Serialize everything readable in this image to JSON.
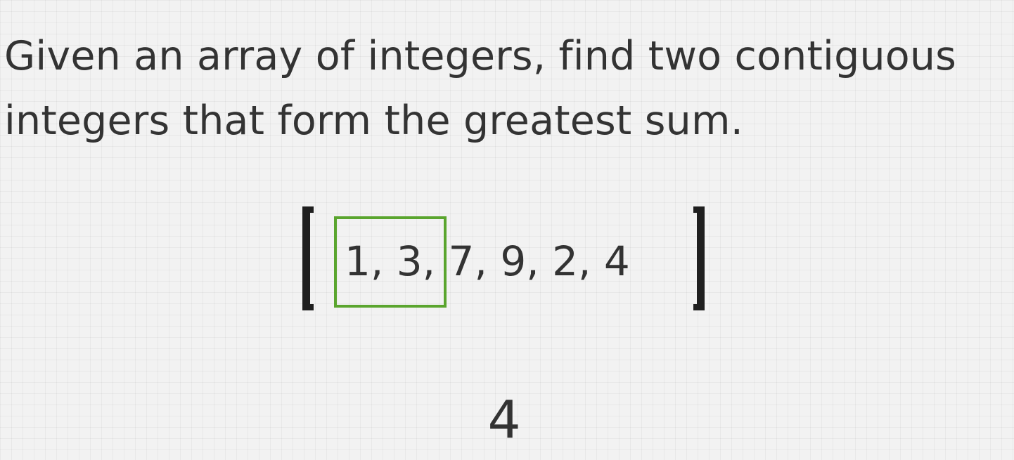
{
  "prompt": {
    "line1": "Given an array of integers, find two contiguous",
    "line2": "integers that form the greatest sum."
  },
  "array": {
    "display": "1, 3, 7, 9, 2, 4",
    "values": [
      1,
      3,
      7,
      9,
      2,
      4
    ],
    "highlighted_window": [
      1,
      3
    ],
    "highlight_color": "#5aa52e"
  },
  "result": {
    "value": "4"
  }
}
